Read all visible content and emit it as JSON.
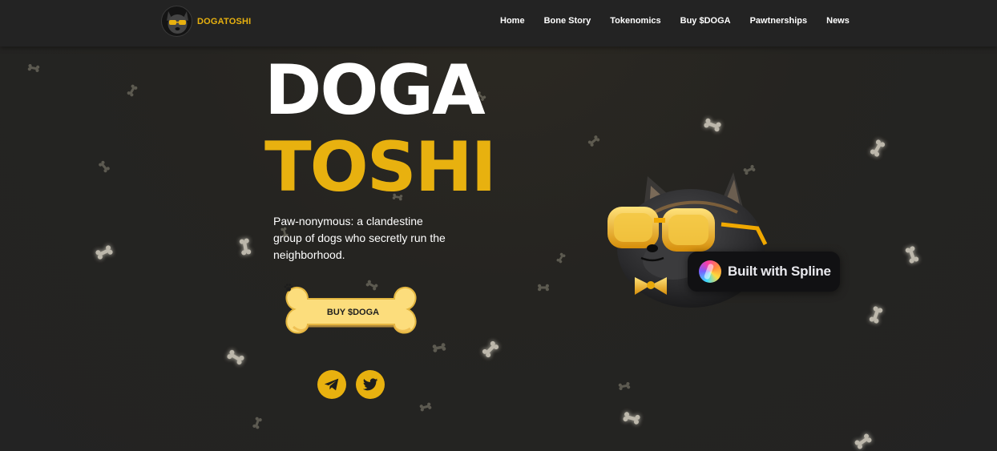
{
  "nav": {
    "brand": "DOGATOSHI",
    "links": [
      "Home",
      "Bone Story",
      "Tokenomics",
      "Buy $DOGA",
      "Pawtnerships",
      "News"
    ]
  },
  "hero": {
    "title_line1": "DOGA",
    "title_line2": "TOSHI",
    "tagline": "Paw-nonymous: a clandestine group of dogs who secretly run the neighborhood.",
    "buy_label": "BUY $DOGA"
  },
  "social": [
    "telegram-icon",
    "twitter-icon"
  ],
  "badge": {
    "label": "Built with Spline"
  },
  "colors": {
    "accent": "#e8b10f",
    "background": "#232323",
    "bone_button": "#fcdd7c"
  }
}
